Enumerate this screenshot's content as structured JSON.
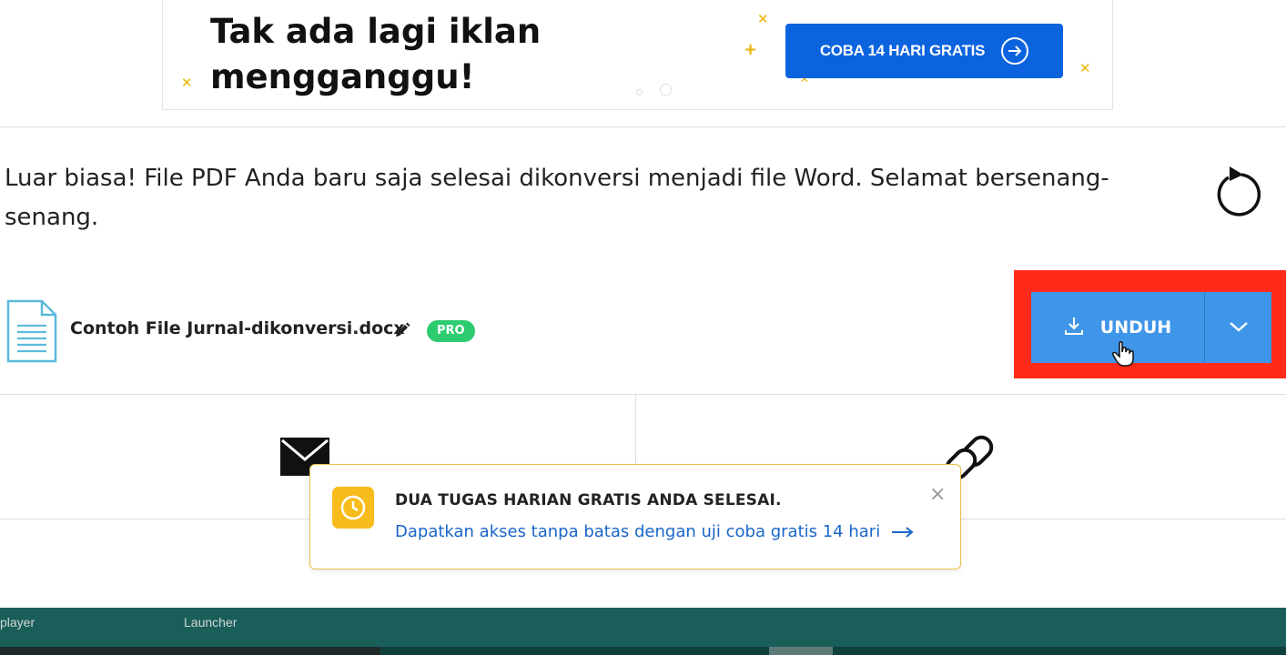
{
  "ad": {
    "headline": "Tak ada lagi iklan mengganggu!",
    "cta_label": "COBA 14 HARI GRATIS"
  },
  "result": {
    "message": "Luar biasa! File PDF Anda baru saja selesai dikonversi menjadi file Word. Selamat bersenang-senang."
  },
  "file": {
    "name": "Contoh File Jurnal-dikonversi.docx",
    "badge": "PRO"
  },
  "download": {
    "label": "UNDUH"
  },
  "toast": {
    "title": "DUA TUGAS HARIAN GRATIS ANDA SELESAI.",
    "link": "Dapatkan akses tanpa batas dengan uji coba gratis 14 hari",
    "close": "×"
  },
  "taskbar": {
    "items": [
      "player",
      "Launcher"
    ]
  },
  "colors": {
    "cta_blue": "#0b63de",
    "download_blue": "#3f95e8",
    "highlight_red": "#ff2a1a",
    "pro_green": "#2ecc71",
    "toast_yellow": "#f7bc1c",
    "taskbar_teal": "#1a5e5a"
  },
  "icons": [
    "restart-icon",
    "document-icon",
    "pencil-icon",
    "download-icon",
    "chevron-down-icon",
    "mail-icon",
    "link-icon",
    "clock-icon",
    "arrow-right-icon",
    "close-icon"
  ]
}
